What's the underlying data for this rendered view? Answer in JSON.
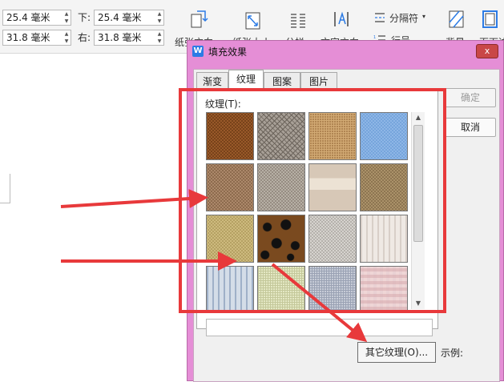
{
  "toolbar": {
    "margin_top_value": "25.4 毫米",
    "margin_bottom_value": "31.8 毫米",
    "label_down": "下:",
    "label_right": "右:",
    "margin_down_value": "25.4 毫米",
    "margin_right_value": "31.8 毫米",
    "separator_label": "分隔符",
    "btn_orientation": "纸张方向",
    "btn_size": "纸张大小",
    "btn_columns": "分栏",
    "btn_text_direction": "文字方向",
    "btn_line_numbers": "行号",
    "btn_background": "背景",
    "btn_page_border": "页面边"
  },
  "dialog": {
    "logo": "W",
    "title": "填充效果",
    "close_label": "x",
    "tabs": [
      "渐变",
      "纹理",
      "图案",
      "图片"
    ],
    "active_tab": 1,
    "texture_label": "纹理(T):",
    "ok_label": "确定",
    "cancel_label": "取消",
    "other_texture_label": "其它纹理(O)...",
    "sample_label": "示例:",
    "texture_name": ""
  },
  "textures": [
    {
      "name": "brown-leather",
      "base": "#6b3a14",
      "accent": "#9a5a2a"
    },
    {
      "name": "fossil",
      "base": "#a79f96",
      "accent": "#6c645c"
    },
    {
      "name": "burlap",
      "base": "#b08552",
      "accent": "#d2aa74"
    },
    {
      "name": "blue-tissue",
      "base": "#6d9fd8",
      "accent": "#8fb7e6"
    },
    {
      "name": "recycled-paper",
      "base": "#b89374",
      "accent": "#8c6a4d"
    },
    {
      "name": "granite",
      "base": "#c4bdb3",
      "accent": "#948b80"
    },
    {
      "name": "parchment",
      "base": "#d7c8b7",
      "accent": "#ece2d4"
    },
    {
      "name": "sand",
      "base": "#b69c72",
      "accent": "#8c7450"
    },
    {
      "name": "canvas-yellow",
      "base": "#d7c488",
      "accent": "#b4a062"
    },
    {
      "name": "leopard",
      "base": "#7a4a1f",
      "accent": "#111111"
    },
    {
      "name": "newsprint",
      "base": "#e2e0dc",
      "accent": "#b4b0aa"
    },
    {
      "name": "white-marble",
      "base": "#efe9e4",
      "accent": "#d8cfc8"
    },
    {
      "name": "denim-stripe",
      "base": "#d4dde8",
      "accent": "#9fb0c8"
    },
    {
      "name": "green-weave",
      "base": "#e4e8c4",
      "accent": "#c4c89a"
    },
    {
      "name": "blue-weave",
      "base": "#c7ccd7",
      "accent": "#9aa2b4"
    },
    {
      "name": "pink-gingham",
      "base": "#efd6d6",
      "accent": "#d6a8ac"
    }
  ],
  "colors": {
    "dialog_frame": "#e58ed6",
    "highlight": "#e8393b"
  }
}
